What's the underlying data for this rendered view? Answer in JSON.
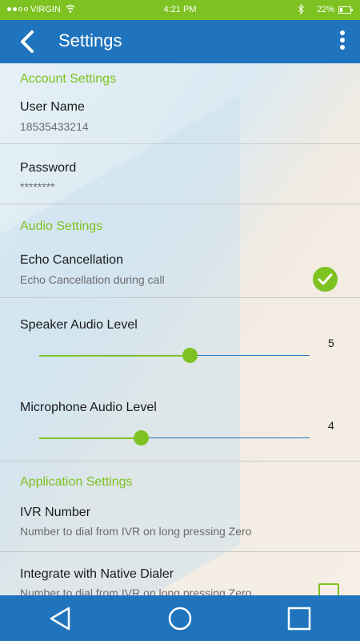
{
  "status_bar": {
    "carrier": "VIRGIN",
    "time": "4:21 PM",
    "battery": "22%",
    "icons": [
      "signal-icon",
      "wifi-icon",
      "bluetooth-icon",
      "battery-icon"
    ]
  },
  "app_bar": {
    "title": "Settings",
    "back_icon": "chevron-left-icon",
    "more_icon": "more-vertical-icon",
    "color": "#1f74bd"
  },
  "sections": {
    "account": {
      "header": "Account Settings",
      "username_label": "User Name",
      "username_value": "18535433214",
      "password_label": "Password",
      "password_value": "********"
    },
    "audio": {
      "header": "Audio Settings",
      "echo_label": "Echo Cancellation",
      "echo_sub": "Echo Cancellation during call",
      "echo_enabled": true,
      "speaker_label": "Speaker Audio Level",
      "speaker_value": "5",
      "speaker_level": 0.56,
      "mic_label": "Microphone Audio Level",
      "mic_value": "4",
      "mic_level": 0.38
    },
    "application": {
      "header": "Application Settings",
      "ivr_label": "IVR Number",
      "ivr_sub": "Number to dial from IVR on long pressing Zero",
      "dialer_label": "Integrate with Native Dialer",
      "dialer_sub": "Number to dial from IVR on long pressing Zero",
      "dialer_enabled": false
    }
  },
  "accent_color": "#7dc221",
  "nav_bar": {
    "icons": [
      "back-triangle-icon",
      "home-circle-icon",
      "recents-square-icon"
    ]
  }
}
